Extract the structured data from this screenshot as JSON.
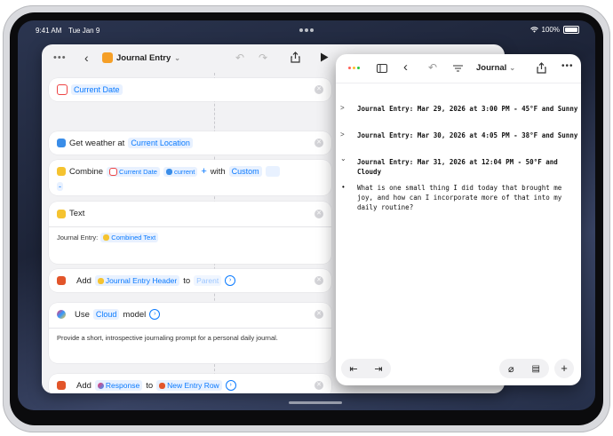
{
  "status": {
    "time": "9:41 AM",
    "date": "Tue Jan 9",
    "battery": "100%"
  },
  "shortcuts": {
    "title": "Journal Entry",
    "actions": {
      "current_date": {
        "token": "Current Date"
      },
      "weather": {
        "label": "Get weather at",
        "token": "Current Location"
      },
      "combine": {
        "label": "Combine",
        "token1": "Current Date",
        "token2": "current",
        "plus": "+",
        "with": "with",
        "token3": "Custom",
        "trailing": "-"
      },
      "text": {
        "title": "Text",
        "body_prefix": "Journal Entry:",
        "body_token": "Combined Text"
      },
      "add1": {
        "label": "Add",
        "token": "Journal Entry Header",
        "to": "to",
        "target": "Parent"
      },
      "use_model": {
        "label": "Use",
        "token": "Cloud",
        "suffix": "model",
        "prompt": "Provide a short, introspective journaling prompt for a personal daily journal."
      },
      "add2": {
        "label": "Add",
        "token": "Response",
        "to": "to",
        "target": "New Entry Row"
      }
    }
  },
  "notes": {
    "title": "Journal",
    "entries": [
      {
        "text": "Journal Entry: Mar 29, 2026 at 3:00 PM - 45°F and Sunny",
        "chevron": ">"
      },
      {
        "text": "Journal Entry: Mar 30, 2026 at 4:05 PM - 38°F and Sunny",
        "chevron": ">"
      },
      {
        "text": "Journal Entry: Mar 31, 2026 at 12:04 PM - 50°F and Cloudy",
        "chevron": "⌄"
      }
    ],
    "body": "What is one small thing I did today that brought me joy, and how can I incorporate more of that into my daily routine?",
    "bullet": "•"
  },
  "icons": [
    "calendar-icon",
    "weather-icon",
    "text-icon",
    "table-icon",
    "ai-model-icon",
    "share-icon",
    "play-icon",
    "sidebar-icon",
    "undo-icon",
    "redo-icon",
    "filter-icon",
    "more-icon",
    "outdent-icon",
    "indent-icon",
    "attachment-icon",
    "comment-icon",
    "add-icon"
  ],
  "colors": {
    "accent": "#0a7aff",
    "shortcut_app": "#f59f27"
  }
}
